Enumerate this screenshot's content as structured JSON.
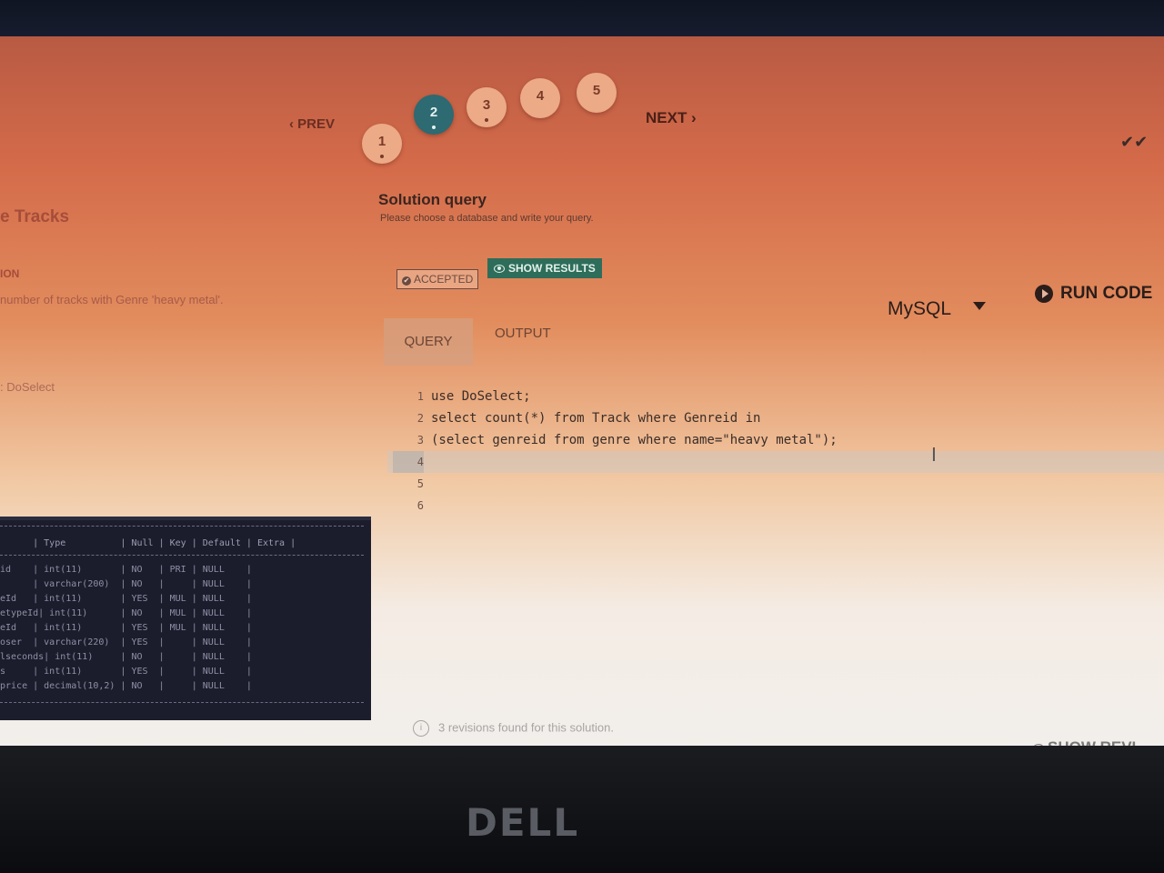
{
  "pager": {
    "prev": "‹ PREV",
    "pages": [
      "1",
      "2",
      "3",
      "4",
      "5"
    ],
    "active_page": "2",
    "next": "NEXT ›"
  },
  "left": {
    "title": "e Tracks",
    "section": "ION",
    "description": "number of tracks with Genre 'heavy metal'.",
    "database": ": DoSelect"
  },
  "schema": {
    "header": "      | Type          | Null | Key | Default | Extra |",
    "rows": [
      "id    | int(11)       | NO   | PRI | NULL    |",
      "      | varchar(200)  | NO   |     | NULL    |",
      "eId   | int(11)       | YES  | MUL | NULL    |",
      "etypeId| int(11)      | NO   | MUL | NULL    |",
      "eId   | int(11)       | YES  | MUL | NULL    |",
      "oser  | varchar(220)  | YES  |     | NULL    |",
      "lseconds| int(11)     | NO   |     | NULL    |",
      "s     | int(11)       | YES  |     | NULL    |",
      "price | decimal(10,2) | NO   |     | NULL    |"
    ]
  },
  "solution": {
    "title": "Solution query",
    "subtitle": "Please choose a database and write your query.",
    "accepted": "ACCEPTED",
    "show_results": "SHOW RESULTS",
    "db_select": "MySQL",
    "run_code": "RUN CODE",
    "tabs": [
      "QUERY",
      "OUTPUT"
    ]
  },
  "editor": {
    "line_numbers": [
      "1",
      "2",
      "3",
      "4",
      "5",
      "6"
    ],
    "lines": [
      "use DoSelect;",
      "select count(*) from Track where Genreid in",
      "(select genreid from genre where name=\"heavy metal\");",
      "",
      "",
      ""
    ]
  },
  "footer": {
    "revisions": "3 revisions found for this solution.",
    "show_revisions": "SHOW REVI"
  },
  "device_brand": "DELL"
}
